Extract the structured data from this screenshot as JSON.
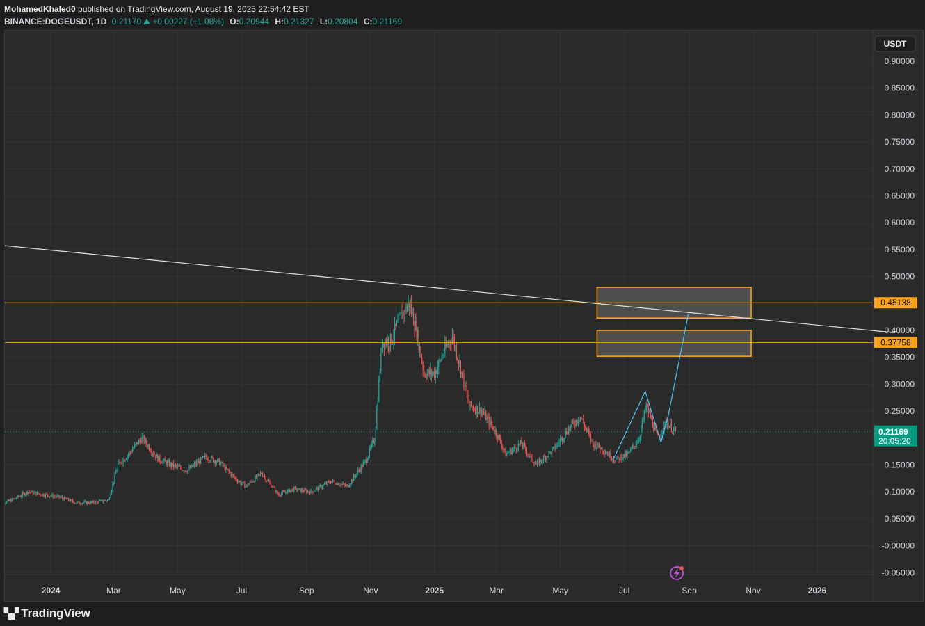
{
  "header": {
    "published": "MohamedKhaled0 published on TradingView.com, August 19, 2025 22:54:42 EST",
    "author": "MohamedKhaled0",
    "published_rest": " published on TradingView.com, August 19, 2025 22:54:42 EST",
    "symbol": "BINANCE:DOGEUSDT, 1D",
    "last": "0.21170",
    "change": "+0.00227 (+1.08%)",
    "o_label": "O:",
    "o": "0.20944",
    "h_label": "H:",
    "h": "0.21327",
    "l_label": "L:",
    "l": "0.20804",
    "c_label": "C:",
    "c": "0.21169"
  },
  "footer": {
    "brand": "TradingView",
    "logo_icon": "tradingview-logo-icon"
  },
  "currency_badge": "USDT",
  "colors": {
    "up": "#26a69a",
    "down": "#ef5350",
    "orange": "#f7a21b",
    "cyan": "#4fc3f7",
    "trendline": "#e0e0e0",
    "price_badge": "#089981",
    "zone_fill": "#555555"
  },
  "chart_data": {
    "type": "candlestick",
    "symbol": "BINANCE:DOGEUSDT",
    "interval": "1D",
    "ylim": [
      -0.05,
      0.9
    ],
    "y_ticks": [
      "0.90000",
      "0.85000",
      "0.80000",
      "0.75000",
      "0.70000",
      "0.65000",
      "0.60000",
      "0.55000",
      "0.50000",
      "0.45000",
      "0.40000",
      "0.35000",
      "0.30000",
      "0.25000",
      "0.20000",
      "0.15000",
      "0.10000",
      "0.05000",
      "-0.00000",
      "-0.05000"
    ],
    "x_ticks": [
      {
        "label": "2024",
        "t": "2024-01-01",
        "bold": true
      },
      {
        "label": "Mar",
        "t": "2024-03-01"
      },
      {
        "label": "May",
        "t": "2024-05-01"
      },
      {
        "label": "Jul",
        "t": "2024-07-01"
      },
      {
        "label": "Sep",
        "t": "2024-09-01"
      },
      {
        "label": "Nov",
        "t": "2024-11-01"
      },
      {
        "label": "2025",
        "t": "2025-01-01",
        "bold": true
      },
      {
        "label": "Mar",
        "t": "2025-03-01"
      },
      {
        "label": "May",
        "t": "2025-05-01"
      },
      {
        "label": "Jul",
        "t": "2025-07-01"
      },
      {
        "label": "Sep",
        "t": "2025-09-01"
      },
      {
        "label": "Nov",
        "t": "2025-11-01"
      },
      {
        "label": "2026",
        "t": "2026-01-01",
        "bold": true
      }
    ],
    "x_range": [
      "2023-11-10",
      "2026-03-15"
    ],
    "price_path": [
      [
        "2023-11-10",
        0.075
      ],
      [
        "2023-11-25",
        0.085
      ],
      [
        "2023-12-10",
        0.1
      ],
      [
        "2023-12-25",
        0.095
      ],
      [
        "2024-01-10",
        0.09
      ],
      [
        "2024-01-25",
        0.08
      ],
      [
        "2024-02-10",
        0.08
      ],
      [
        "2024-02-25",
        0.085
      ],
      [
        "2024-03-05",
        0.15
      ],
      [
        "2024-03-15",
        0.17
      ],
      [
        "2024-03-28",
        0.2
      ],
      [
        "2024-04-05",
        0.18
      ],
      [
        "2024-04-13",
        0.16
      ],
      [
        "2024-04-25",
        0.15
      ],
      [
        "2024-05-10",
        0.14
      ],
      [
        "2024-05-28",
        0.165
      ],
      [
        "2024-06-10",
        0.155
      ],
      [
        "2024-06-25",
        0.125
      ],
      [
        "2024-07-05",
        0.11
      ],
      [
        "2024-07-20",
        0.135
      ],
      [
        "2024-08-05",
        0.095
      ],
      [
        "2024-08-20",
        0.105
      ],
      [
        "2024-09-05",
        0.1
      ],
      [
        "2024-09-25",
        0.12
      ],
      [
        "2024-10-10",
        0.11
      ],
      [
        "2024-10-28",
        0.16
      ],
      [
        "2024-11-05",
        0.2
      ],
      [
        "2024-11-12",
        0.38
      ],
      [
        "2024-11-20",
        0.38
      ],
      [
        "2024-12-01",
        0.43
      ],
      [
        "2024-12-08",
        0.45
      ],
      [
        "2024-12-15",
        0.4
      ],
      [
        "2024-12-22",
        0.32
      ],
      [
        "2025-01-01",
        0.32
      ],
      [
        "2025-01-10",
        0.36
      ],
      [
        "2025-01-18",
        0.39
      ],
      [
        "2025-01-26",
        0.33
      ],
      [
        "2025-02-03",
        0.26
      ],
      [
        "2025-02-15",
        0.25
      ],
      [
        "2025-03-01",
        0.21
      ],
      [
        "2025-03-10",
        0.17
      ],
      [
        "2025-03-25",
        0.19
      ],
      [
        "2025-04-08",
        0.15
      ],
      [
        "2025-04-25",
        0.18
      ],
      [
        "2025-05-10",
        0.22
      ],
      [
        "2025-05-20",
        0.24
      ],
      [
        "2025-06-01",
        0.19
      ],
      [
        "2025-06-10",
        0.18
      ],
      [
        "2025-06-22",
        0.16
      ],
      [
        "2025-07-05",
        0.17
      ],
      [
        "2025-07-15",
        0.2
      ],
      [
        "2025-07-22",
        0.26
      ],
      [
        "2025-08-02",
        0.2
      ],
      [
        "2025-08-10",
        0.23
      ],
      [
        "2025-08-19",
        0.2117
      ]
    ],
    "horizontal_levels": [
      0.45138,
      0.37758
    ],
    "level_labels": [
      "0.45138",
      "0.37758"
    ],
    "zones": [
      {
        "from": "2025-06-05",
        "to": "2025-10-30",
        "top": 0.48,
        "bottom": 0.423
      },
      {
        "from": "2025-06-05",
        "to": "2025-10-30",
        "top": 0.4,
        "bottom": 0.352
      }
    ],
    "trendline": [
      [
        "2023-11-10",
        0.559
      ],
      [
        "2026-03-15",
        0.396
      ]
    ],
    "projection_path": [
      [
        "2025-06-21",
        0.162
      ],
      [
        "2025-07-21",
        0.287
      ],
      [
        "2025-08-05",
        0.192
      ],
      [
        "2025-08-12",
        0.242
      ],
      [
        "2025-08-31",
        0.43
      ]
    ],
    "last_price": "0.21169",
    "countdown": "20:05:20"
  }
}
